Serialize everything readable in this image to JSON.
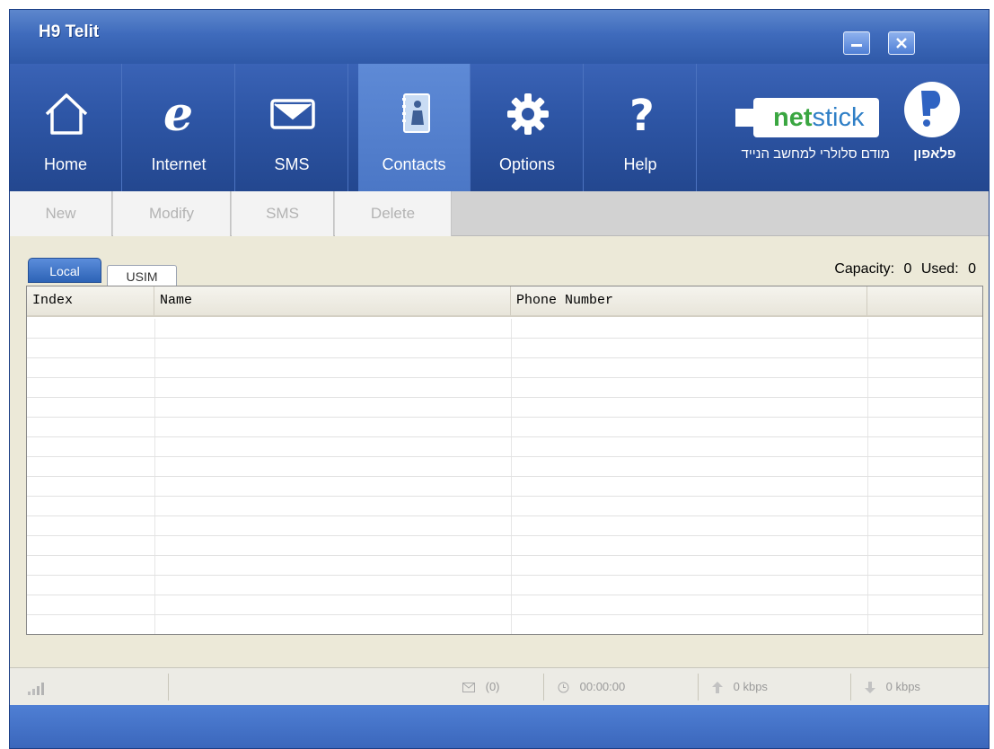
{
  "window": {
    "title": "H9 Telit"
  },
  "nav": {
    "items": [
      {
        "label": "Home",
        "icon": "home-icon"
      },
      {
        "label": "Internet",
        "icon": "internet-icon"
      },
      {
        "label": "SMS",
        "icon": "envelope-icon"
      },
      {
        "label": "Contacts",
        "icon": "contacts-book-icon",
        "active": true
      },
      {
        "label": "Options",
        "icon": "gear-icon"
      },
      {
        "label": "Help",
        "icon": "question-icon"
      }
    ]
  },
  "brand": {
    "logo_net": "net",
    "logo_stick": "stick",
    "tagline": "מודם סלולרי למחשב הנייד",
    "company": "פלאפון"
  },
  "actions": {
    "new": "New",
    "modify": "Modify",
    "sms": "SMS",
    "delete": "Delete"
  },
  "tabs": {
    "local": "Local",
    "usim": "USIM"
  },
  "capacity": {
    "capacity_label": "Capacity:",
    "capacity_value": "0",
    "used_label": "Used:",
    "used_value": "0"
  },
  "table": {
    "columns": [
      "Index",
      "Name",
      "Phone Number",
      ""
    ],
    "rows": []
  },
  "status": {
    "sms_count": "(0)",
    "duration": "00:00:00",
    "upload": "0 kbps",
    "download": "0 kbps"
  },
  "colors": {
    "titlebar": "#3f6bbc",
    "navbar": "#2e56a6",
    "active_tab": "#5e8ad6",
    "netstick_green": "#3aa641"
  }
}
